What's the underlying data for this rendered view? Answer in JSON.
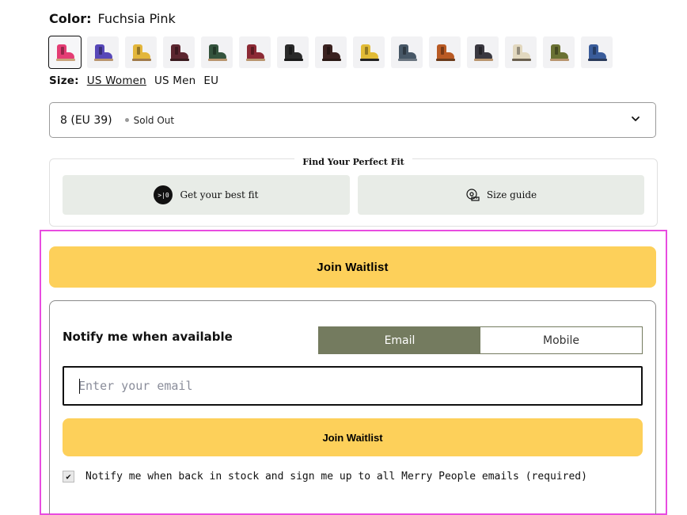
{
  "color": {
    "label": "Color:",
    "value": "Fuchsia Pink"
  },
  "swatches": [
    {
      "name": "fuchsia",
      "color": "#e43d74",
      "sole": "#c9a47c",
      "selected": true
    },
    {
      "name": "purple",
      "color": "#5747b8",
      "sole": "#b8956e"
    },
    {
      "name": "yellow",
      "color": "#e3b63c",
      "sole": "#a07a4a"
    },
    {
      "name": "burgundy-dark",
      "color": "#5c2630",
      "sole": "#3a1a1e"
    },
    {
      "name": "forest",
      "color": "#34533d",
      "sole": "#b8956e"
    },
    {
      "name": "wine",
      "color": "#8c2a35",
      "sole": "#b8956e"
    },
    {
      "name": "black",
      "color": "#2a2a2a",
      "sole": "#1a1a1a"
    },
    {
      "name": "chocolate",
      "color": "#3b2220",
      "sole": "#2a1814"
    },
    {
      "name": "mustard-black",
      "color": "#e1bb36",
      "sole": "#222222"
    },
    {
      "name": "slate",
      "color": "#475766",
      "sole": "#6a7580"
    },
    {
      "name": "tan",
      "color": "#b95a24",
      "sole": "#6a3a1a"
    },
    {
      "name": "charcoal",
      "color": "#3a3840",
      "sole": "#b8956e"
    },
    {
      "name": "cream",
      "color": "#e2d8bf",
      "sole": "#6a6050"
    },
    {
      "name": "olive",
      "color": "#6a7133",
      "sole": "#b8956e"
    },
    {
      "name": "navy",
      "color": "#3a5c9a",
      "sole": "#2a3a5a"
    }
  ],
  "size": {
    "label": "Size:",
    "options": [
      "US Women",
      "US Men",
      "EU"
    ],
    "selected_value": "8 (EU 39)",
    "status": "Sold Out"
  },
  "fit": {
    "title": "Find Your Perfect Fit",
    "best_fit_logo": ">|0",
    "best_fit_label": "Get your best fit",
    "size_guide_label": "Size guide"
  },
  "waitlist": {
    "join_main_label": "Join Waitlist",
    "notify_title": "Notify me when available",
    "tab_email": "Email",
    "tab_mobile": "Mobile",
    "email_placeholder": "Enter your email",
    "join_small_label": "Join Waitlist",
    "consent_text": "Notify me when back in stock and sign me up to all Merry People emails (required)",
    "consent_checked": true,
    "checkmark": "✔"
  },
  "colors": {
    "accent_yellow": "#fdd05a",
    "toggle_active": "#747b5f",
    "highlight": "#e84ce0"
  }
}
